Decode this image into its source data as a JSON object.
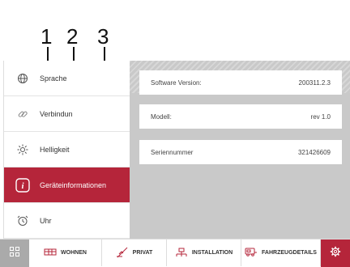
{
  "callouts": [
    "1",
    "2",
    "3"
  ],
  "sidebar": {
    "items": [
      {
        "label": "Sprache",
        "icon": "globe-icon",
        "active": false
      },
      {
        "label": "Verbindun",
        "icon": "link-icon",
        "active": false
      },
      {
        "label": "Helligkeit",
        "icon": "brightness-icon",
        "active": false
      },
      {
        "label": "Geräteinformationen",
        "icon": "info-icon",
        "active": true
      },
      {
        "label": "Uhr",
        "icon": "alarm-clock-icon",
        "active": false
      }
    ]
  },
  "info": {
    "rows": [
      {
        "label": "Software Version:",
        "value": "200311.2.3"
      },
      {
        "label": "Modell:",
        "value": "rev 1.0"
      },
      {
        "label": "Seriennummer",
        "value": "321426609"
      }
    ]
  },
  "bottombar": {
    "tabs": [
      {
        "label": "WOHNEN",
        "icon": "living-icon"
      },
      {
        "label": "PRIVAT",
        "icon": "private-icon"
      },
      {
        "label": "INSTALLATION",
        "icon": "installation-icon"
      },
      {
        "label": "FAHRZEUGDETAILS",
        "icon": "vehicle-icon"
      }
    ]
  },
  "colors": {
    "accent": "#b5253a",
    "panel_bg": "#c9c9c9"
  }
}
